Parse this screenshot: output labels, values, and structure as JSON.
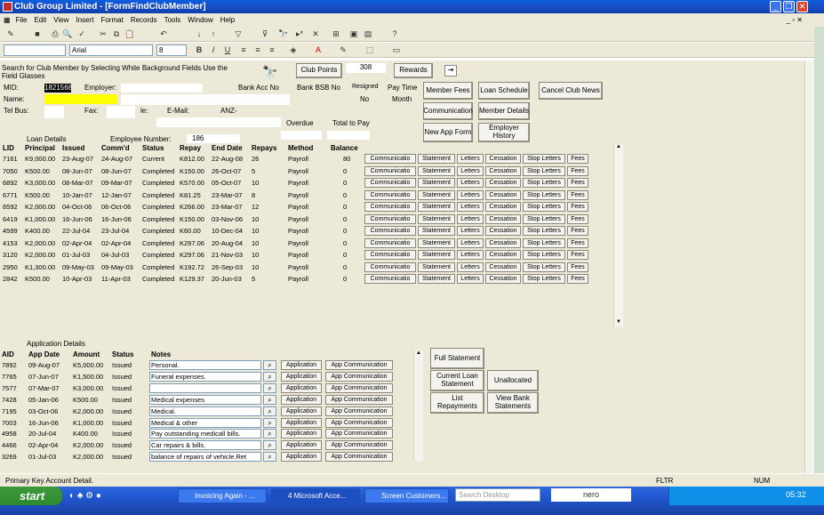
{
  "window": {
    "title": "Club Group Limited - [FormFindClubMember]"
  },
  "menu": [
    "File",
    "Edit",
    "View",
    "Insert",
    "Format",
    "Records",
    "Tools",
    "Window",
    "Help"
  ],
  "toolbar": {
    "font": "Arial",
    "size": "8",
    "bold": "B",
    "italic": "I",
    "underline": "U"
  },
  "search": {
    "instruction": "Search for Club Member by Selecting White Background Fields  Use the Field Glasses",
    "club_points_label": "Club Points",
    "points_value": "308",
    "rewards_label": "Rewards"
  },
  "member": {
    "mid_label": "MID:",
    "mid_value": "1821568",
    "employer_label": "Employer:",
    "name_label": "Name:",
    "telbus_label": "Tel Bus:",
    "fax_label": "Fax:",
    "e_label": "le:",
    "email_label": "E-Mail:",
    "anz": "ANZ-",
    "bank_acc_label": "Bank Acc No",
    "bank_bsb_label": "Bank BSB No",
    "resigned_label": "Resigned",
    "resigned_value": "No",
    "pay_time_label": "Pay Time",
    "pay_time_value": "Month",
    "overdue_label": "Overdue",
    "total_to_pay_label": "Total to Pay",
    "loan_details_label": "Loan Details",
    "employee_number_label": "Employee Number:",
    "employee_number_value": "186"
  },
  "buttons": {
    "member_fees": "Member Fees",
    "loan_schedule": "Loan Schedule",
    "cancel_club_news": "Cancel Club News",
    "communication": "Communication",
    "member_details": "Member Details",
    "new_app_form": "New App Form",
    "employer_history": "Employer History"
  },
  "loan_headers": [
    "LID",
    "Principal",
    "Issued",
    "Comm'd",
    "Status",
    "Repay",
    "End Date",
    "Repays",
    "Method",
    "Balance"
  ],
  "loan_buttons": [
    "Communicatio",
    "Statement",
    "Letters",
    "Cessation",
    "Stop Letters",
    "Fees"
  ],
  "loans": [
    [
      "7161",
      "K9,000.00",
      "23-Aug-07",
      "24-Aug-07",
      "Current",
      "K812.00",
      "22-Aug-08",
      "26",
      "Payroll",
      "80"
    ],
    [
      "7050",
      "K500.00",
      "08-Jun-07",
      "08-Jun-07",
      "Completed",
      "K150.00",
      "26-Oct-07",
      "5",
      "Payroll",
      "0"
    ],
    [
      "6892",
      "K3,000.00",
      "08-Mar-07",
      "09-Mar-07",
      "Completed",
      "K570.00",
      "05-Oct-07",
      "10",
      "Payroll",
      "0"
    ],
    [
      "6771",
      "K500.00",
      "10-Jan-07",
      "12-Jan-07",
      "Completed",
      "K81.25",
      "23-Mar-07",
      "8",
      "Payroll",
      "0"
    ],
    [
      "6592",
      "K2,000.00",
      "04-Oct-06",
      "06-Oct-06",
      "Completed",
      "K266.00",
      "23-Mar-07",
      "12",
      "Payroll",
      "0"
    ],
    [
      "6419",
      "K1,000.00",
      "16-Jun-06",
      "16-Jun-06",
      "Completed",
      "K150.00",
      "03-Nov-06",
      "10",
      "Payroll",
      "0"
    ],
    [
      "4599",
      "K400.00",
      "22-Jul-04",
      "23-Jul-04",
      "Completed",
      "K60.00",
      "10-Dec-04",
      "10",
      "Payroll",
      "0"
    ],
    [
      "4153",
      "K2,000.00",
      "02-Apr-04",
      "02-Apr-04",
      "Completed",
      "K297.06",
      "20-Aug-04",
      "10",
      "Payroll",
      "0"
    ],
    [
      "3120",
      "K2,000.00",
      "01-Jul-03",
      "04-Jul-03",
      "Completed",
      "K297.06",
      "21-Nov-03",
      "10",
      "Payroll",
      "0"
    ],
    [
      "2950",
      "K1,300.00",
      "09-May-03",
      "09-May-03",
      "Completed",
      "K192.72",
      "26-Sep-03",
      "10",
      "Payroll",
      "0"
    ],
    [
      "2842",
      "K500.00",
      "10-Apr-03",
      "11-Apr-03",
      "Completed",
      "K129.37",
      "20-Jun-03",
      "5",
      "Payroll",
      "0"
    ]
  ],
  "app_section": {
    "label": "Application Details",
    "headers": [
      "AID",
      "App Date",
      "Amount",
      "Status",
      "Notes"
    ],
    "btn_application": "Application",
    "btn_app_comm": "App Communication"
  },
  "apps": [
    [
      "7892",
      "09-Aug-07",
      "K5,000.00",
      "Issued",
      "Personal."
    ],
    [
      "7765",
      "07-Jun-07",
      "K1,500.00",
      "Issued",
      "Funeral expenses."
    ],
    [
      "7577",
      "07-Mar-07",
      "K3,000.00",
      "Issued",
      ""
    ],
    [
      "7428",
      "05-Jan-06",
      "K500.00",
      "Issued",
      "Medical expenses"
    ],
    [
      "7195",
      "03-Oct-06",
      "K2,000.00",
      "Issued",
      "Medical."
    ],
    [
      "7003",
      "16-Jun-06",
      "K1,000.00",
      "Issued",
      "Medical & other"
    ],
    [
      "4958",
      "20-Jul-04",
      "K400.00",
      "Issued",
      "Pay outstanding medicall bills."
    ],
    [
      "4466",
      "02-Apr-04",
      "K2,000.00",
      "Issued",
      "Car repairs & bills."
    ],
    [
      "3269",
      "01-Jul-03",
      "K2,000.00",
      "Issued",
      "balance of repairs of vehicle.Ret"
    ]
  ],
  "right_buttons": {
    "full_statement": "Full Statement",
    "current_loan": "Current Loan Statement",
    "unallocated": "Unallocated",
    "list_repayments": "List Repayments",
    "view_bank": "View Bank Statements"
  },
  "status": {
    "text": "Primary Key Account Detail.",
    "fltr": "FLTR",
    "num": "NUM"
  },
  "taskbar": {
    "start": "start",
    "tasks": [
      "Invoicing Again - ...",
      "4 Microsoft Acce...",
      "Screen Customers..."
    ],
    "search_placeholder": "Search Desktop",
    "nero": "nero",
    "clock": "05:32"
  }
}
